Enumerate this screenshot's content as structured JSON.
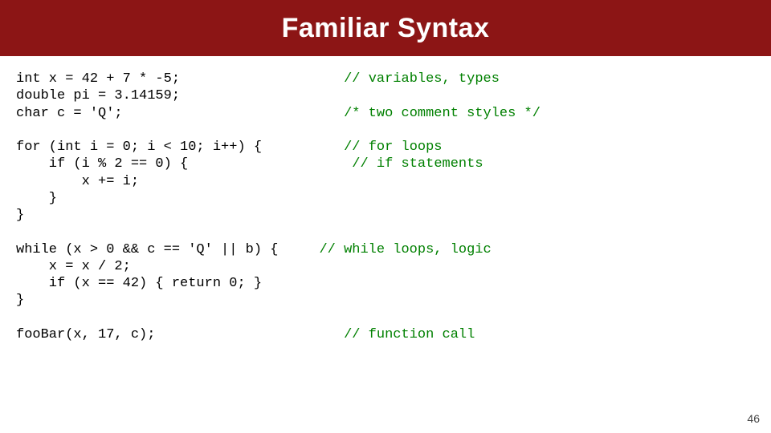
{
  "title": "Familiar Syntax",
  "page_number": "46",
  "code": {
    "l1a": "int x = 42 + 7 * -5;",
    "l1c": "// variables, types",
    "l2a": "double pi = 3.14159;",
    "l3a": "char c = 'Q';",
    "l3c": "/* two comment styles */",
    "l5a": "for (int i = 0; i < 10; i++) {",
    "l5c": "// for loops",
    "l6a": "    if (i % 2 == 0) {",
    "l6c": "// if statements",
    "l7a": "        x += i;",
    "l8a": "    }",
    "l9a": "}",
    "l11a": "while (x > 0 && c == 'Q' || b) {",
    "l11c": "// while loops, logic",
    "l12a": "    x = x / 2;",
    "l13a": "    if (x == 42) { return 0; }",
    "l14a": "}",
    "l16a": "fooBar(x, 17, c);",
    "l16c": "// function call"
  }
}
